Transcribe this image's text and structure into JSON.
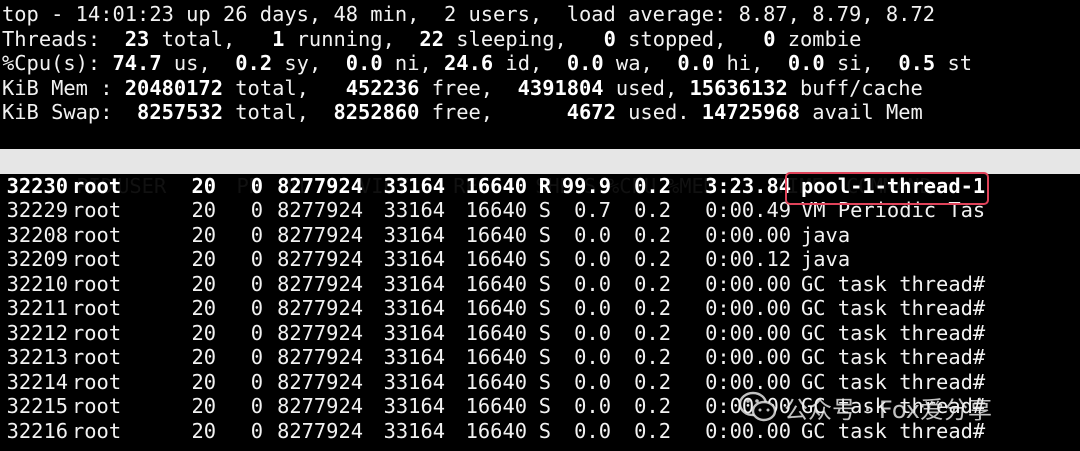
{
  "summary": {
    "line1": "top - 14:01:23 up 26 days, 48 min,  2 users,  load average: 8.87, 8.79, 8.72",
    "threads": [
      {
        "t": "Threads:  ",
        "b": false
      },
      {
        "t": "23",
        "b": true
      },
      {
        "t": " total,   ",
        "b": false
      },
      {
        "t": "1",
        "b": true
      },
      {
        "t": " running,  ",
        "b": false
      },
      {
        "t": "22",
        "b": true
      },
      {
        "t": " sleeping,   ",
        "b": false
      },
      {
        "t": "0",
        "b": true
      },
      {
        "t": " stopped,   ",
        "b": false
      },
      {
        "t": "0",
        "b": true
      },
      {
        "t": " zombie",
        "b": false
      }
    ],
    "cpu": [
      {
        "t": "%Cpu(s): ",
        "b": false
      },
      {
        "t": "74.7",
        "b": true
      },
      {
        "t": " us,  ",
        "b": false
      },
      {
        "t": "0.2",
        "b": true
      },
      {
        "t": " sy,  ",
        "b": false
      },
      {
        "t": "0.0",
        "b": true
      },
      {
        "t": " ni, ",
        "b": false
      },
      {
        "t": "24.6",
        "b": true
      },
      {
        "t": " id,  ",
        "b": false
      },
      {
        "t": "0.0",
        "b": true
      },
      {
        "t": " wa,  ",
        "b": false
      },
      {
        "t": "0.0",
        "b": true
      },
      {
        "t": " hi,  ",
        "b": false
      },
      {
        "t": "0.0",
        "b": true
      },
      {
        "t": " si,  ",
        "b": false
      },
      {
        "t": "0.5",
        "b": true
      },
      {
        "t": " st",
        "b": false
      }
    ],
    "mem": [
      {
        "t": "KiB Mem : ",
        "b": false
      },
      {
        "t": "20480172",
        "b": true
      },
      {
        "t": " total,   ",
        "b": false
      },
      {
        "t": "452236",
        "b": true
      },
      {
        "t": " free,  ",
        "b": false
      },
      {
        "t": "4391804",
        "b": true
      },
      {
        "t": " used, ",
        "b": false
      },
      {
        "t": "15636132",
        "b": true
      },
      {
        "t": " buff/cache",
        "b": false
      }
    ],
    "swap": [
      {
        "t": "KiB Swap:  ",
        "b": false
      },
      {
        "t": "8257532",
        "b": true
      },
      {
        "t": " total,  ",
        "b": false
      },
      {
        "t": "8252860",
        "b": true
      },
      {
        "t": " free,      ",
        "b": false
      },
      {
        "t": "4672",
        "b": true
      },
      {
        "t": " used. ",
        "b": false
      },
      {
        "t": "14725968",
        "b": true
      },
      {
        "t": " avail Mem",
        "b": false
      }
    ]
  },
  "columns": {
    "pid": "PID",
    "user": "USER",
    "pr": "PR",
    "ni": "NI",
    "virt": "VIRT",
    "res": "RES",
    "shr": "SHR",
    "s": "S",
    "cpu": "%CPU",
    "mem": "%MEM",
    "time": "TIME+",
    "command": "COMMAND"
  },
  "processes": [
    {
      "pid": "32230",
      "user": "root",
      "pr": "20",
      "ni": "0",
      "virt": "8277924",
      "res": "33164",
      "shr": "16640",
      "s": "R",
      "cpu": "99.9",
      "mem": "0.2",
      "time": "3:23.84",
      "command": "pool-1-thread-1"
    },
    {
      "pid": "32229",
      "user": "root",
      "pr": "20",
      "ni": "0",
      "virt": "8277924",
      "res": "33164",
      "shr": "16640",
      "s": "S",
      "cpu": "0.7",
      "mem": "0.2",
      "time": "0:00.49",
      "command": "VM Periodic Tas"
    },
    {
      "pid": "32208",
      "user": "root",
      "pr": "20",
      "ni": "0",
      "virt": "8277924",
      "res": "33164",
      "shr": "16640",
      "s": "S",
      "cpu": "0.0",
      "mem": "0.2",
      "time": "0:00.00",
      "command": "java"
    },
    {
      "pid": "32209",
      "user": "root",
      "pr": "20",
      "ni": "0",
      "virt": "8277924",
      "res": "33164",
      "shr": "16640",
      "s": "S",
      "cpu": "0.0",
      "mem": "0.2",
      "time": "0:00.12",
      "command": "java"
    },
    {
      "pid": "32210",
      "user": "root",
      "pr": "20",
      "ni": "0",
      "virt": "8277924",
      "res": "33164",
      "shr": "16640",
      "s": "S",
      "cpu": "0.0",
      "mem": "0.2",
      "time": "0:00.00",
      "command": "GC task thread#"
    },
    {
      "pid": "32211",
      "user": "root",
      "pr": "20",
      "ni": "0",
      "virt": "8277924",
      "res": "33164",
      "shr": "16640",
      "s": "S",
      "cpu": "0.0",
      "mem": "0.2",
      "time": "0:00.00",
      "command": "GC task thread#"
    },
    {
      "pid": "32212",
      "user": "root",
      "pr": "20",
      "ni": "0",
      "virt": "8277924",
      "res": "33164",
      "shr": "16640",
      "s": "S",
      "cpu": "0.0",
      "mem": "0.2",
      "time": "0:00.00",
      "command": "GC task thread#"
    },
    {
      "pid": "32213",
      "user": "root",
      "pr": "20",
      "ni": "0",
      "virt": "8277924",
      "res": "33164",
      "shr": "16640",
      "s": "S",
      "cpu": "0.0",
      "mem": "0.2",
      "time": "0:00.00",
      "command": "GC task thread#"
    },
    {
      "pid": "32214",
      "user": "root",
      "pr": "20",
      "ni": "0",
      "virt": "8277924",
      "res": "33164",
      "shr": "16640",
      "s": "S",
      "cpu": "0.0",
      "mem": "0.2",
      "time": "0:00.00",
      "command": "GC task thread#"
    },
    {
      "pid": "32215",
      "user": "root",
      "pr": "20",
      "ni": "0",
      "virt": "8277924",
      "res": "33164",
      "shr": "16640",
      "s": "S",
      "cpu": "0.0",
      "mem": "0.2",
      "time": "0:00.00",
      "command": "GC task thread#"
    },
    {
      "pid": "32216",
      "user": "root",
      "pr": "20",
      "ni": "0",
      "virt": "8277924",
      "res": "33164",
      "shr": "16640",
      "s": "S",
      "cpu": "0.0",
      "mem": "0.2",
      "time": "0:00.00",
      "command": "GC task thread#"
    }
  ],
  "watermark": {
    "text": "公众号 · Fox爱分享",
    "icon": "wechat-icon"
  },
  "colors": {
    "background": "#000000",
    "text": "#f2f2f2",
    "header_bg": "#e6e6e6",
    "highlight_border": "#e0435a"
  }
}
